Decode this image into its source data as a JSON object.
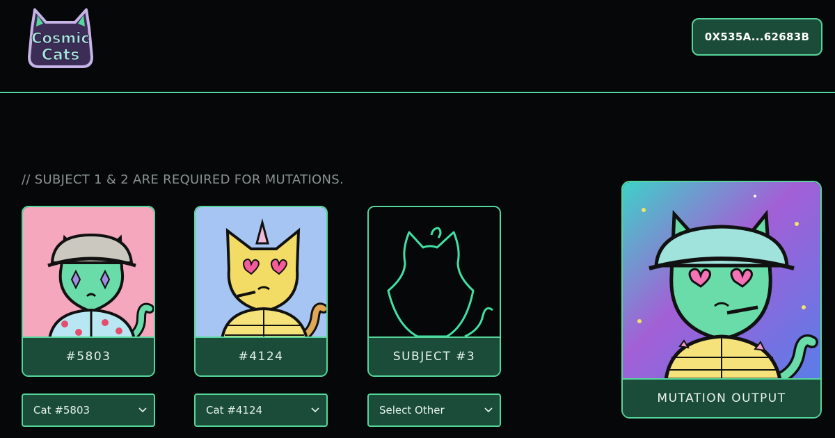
{
  "header": {
    "logo_line1": "Cosmic",
    "logo_line2": "Cats",
    "wallet_label": "0X535A...62683B"
  },
  "main": {
    "note": "// SUBJECT 1 & 2 ARE REQUIRED FOR MUTATIONS.",
    "subjects": [
      {
        "caption": "#5803",
        "select_value": "Cat #5803",
        "art": "cat-5803-pink-bucket-hat"
      },
      {
        "caption": "#4124",
        "select_value": "Cat #4124",
        "art": "cat-4124-blue-puffer-jacket"
      },
      {
        "caption": "SUBJECT #3",
        "select_value": "Select Other",
        "art": "cat-silhouette-placeholder"
      }
    ],
    "output": {
      "caption": "MUTATION OUTPUT",
      "art": "mutated-cat-cosmic-background"
    }
  },
  "colors": {
    "background": "#050708",
    "accent": "#55d69b",
    "panel": "#1a4c39",
    "muted_text": "#8a9490"
  },
  "icons": [
    "chevron-down-icon"
  ]
}
